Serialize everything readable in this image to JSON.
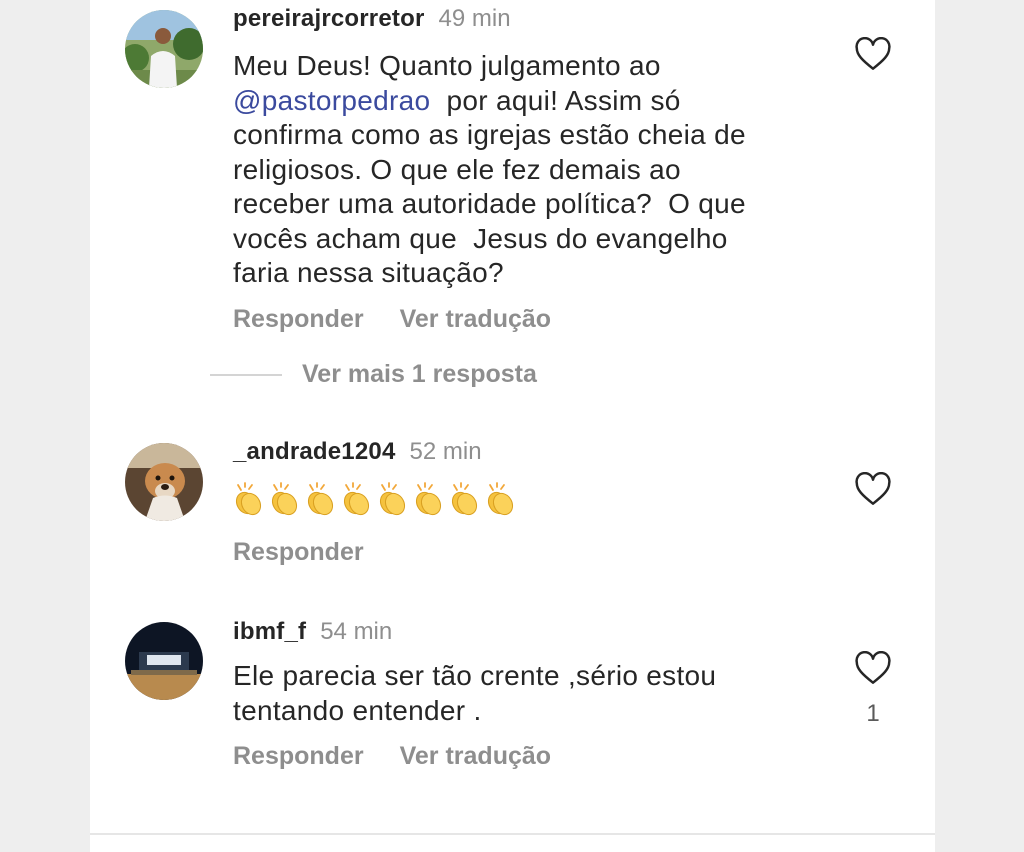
{
  "comments": [
    {
      "username": "pereirajrcorretor",
      "time": "49 min",
      "text_before": "Meu Deus! Quanto julgamento ao\n",
      "mention": "@pastorpedrao",
      "text_after": "  por aqui! Assim só\nconfirma como as igrejas estão cheia de\nreligiosos. O que ele fez demais ao\nreceber uma autoridade política?  O que\nvocês acham que  Jesus do evangelho\nfaria nessa situação?",
      "reply_label": "Responder",
      "translate_label": "Ver tradução"
    },
    {
      "username": "_andrade1204",
      "time": "52 min",
      "emoji": "clapping-hands",
      "emoji_count": 8,
      "reply_label": "Responder"
    },
    {
      "username": "ibmf_f",
      "time": "54 min",
      "text": "Ele parecia ser tão crente ,sério estou\ntentando entender .",
      "reply_label": "Responder",
      "translate_label": "Ver tradução",
      "like_count": "1"
    }
  ],
  "more_replies_label": "Ver mais 1 resposta",
  "icons": {
    "like": "heart-outline-icon"
  },
  "colors": {
    "mention": "#3b4a9e",
    "muted": "#8e8e8e",
    "text": "#262626"
  }
}
